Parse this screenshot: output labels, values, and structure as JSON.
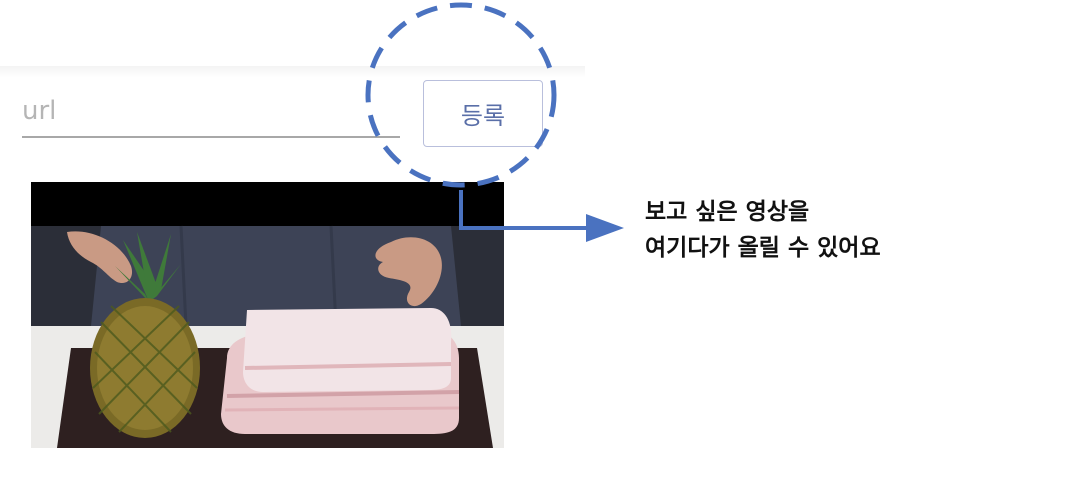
{
  "form": {
    "url_placeholder": "url",
    "url_value": "",
    "register_label": "등록"
  },
  "annotation": {
    "line1": "보고 싶은 영상을",
    "line2": "여기다가 올릴 수 있어요",
    "accent_color": "#4a72c0"
  },
  "video": {
    "icon": "video-thumbnail-image"
  }
}
